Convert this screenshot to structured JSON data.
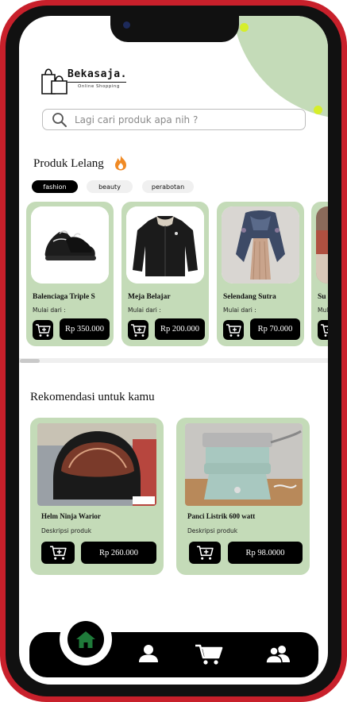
{
  "app": {
    "logo_text": "Bekasaja.",
    "logo_tagline": "Online Shopping"
  },
  "search": {
    "placeholder": "Lagi cari produk apa nih ?"
  },
  "auction": {
    "title": "Produk Lelang",
    "categories": [
      {
        "label": "fashion",
        "active": true
      },
      {
        "label": "beauty",
        "active": false
      },
      {
        "label": "perabotan",
        "active": false
      }
    ],
    "items": [
      {
        "name": "Balenciaga Triple S",
        "sub": "Mulai dari :",
        "price": "Rp 350.000"
      },
      {
        "name": "Meja Belajar",
        "sub": "Mulai dari :",
        "price": "Rp 200.000"
      },
      {
        "name": "Selendang Sutra",
        "sub": "Mulai dari :",
        "price": "Rp 70.000"
      },
      {
        "name": "Su",
        "sub": "Mul",
        "price": ""
      }
    ]
  },
  "recommend": {
    "title": "Rekomendasi untuk kamu",
    "items": [
      {
        "name": "Helm Ninja Warior",
        "sub": "Deskripsi produk",
        "price": "Rp 260.000"
      },
      {
        "name": "Panci Listrik 600 watt",
        "sub": "Deskripsi produk",
        "price": "Rp 98.0000"
      }
    ]
  },
  "icons": {
    "search": "search-icon",
    "flame": "flame-icon",
    "cart_add": "cart-add-icon",
    "home": "home-icon",
    "profile": "person-icon",
    "cart": "cart-icon",
    "community": "users-icon"
  },
  "colors": {
    "frame": "#c8202b",
    "card": "#c4dbb8",
    "accent_dot": "#d6ee2a",
    "home_green": "#1f7a3a",
    "flame": "#f08a24"
  }
}
